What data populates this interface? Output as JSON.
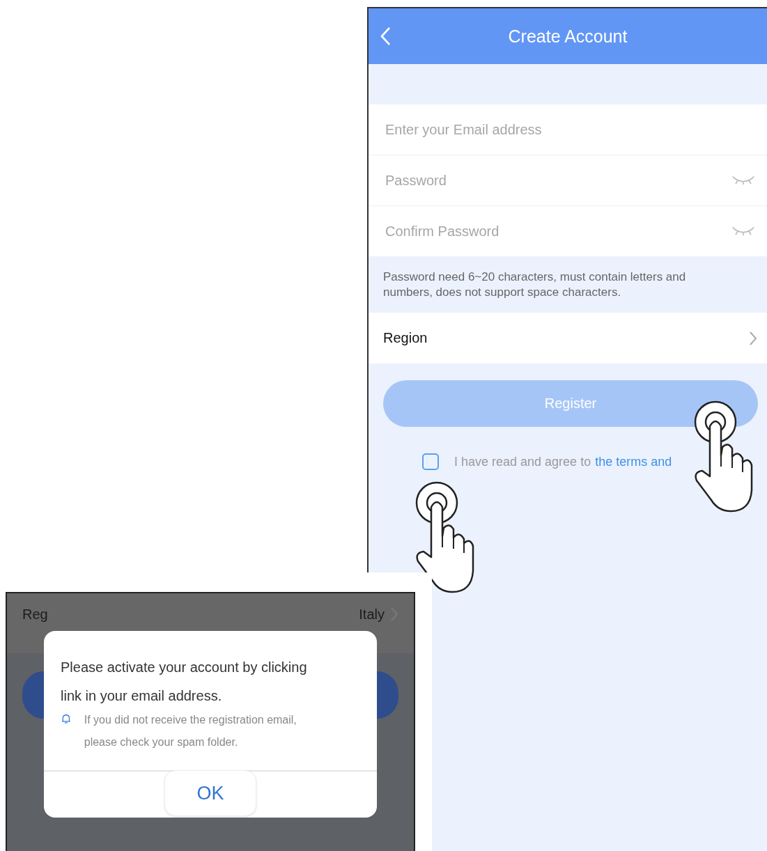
{
  "create_screen": {
    "title": "Create Account",
    "fields": [
      {
        "placeholder": "Enter your Email address",
        "kind": "text"
      },
      {
        "placeholder": "Password",
        "kind": "password"
      },
      {
        "placeholder": "Confirm Password",
        "kind": "password"
      }
    ],
    "hint": "Password need 6~20 characters, must contain letters and numbers, does not support space characters.",
    "region": {
      "label": "Region"
    },
    "register_button": {
      "label": "Register",
      "disabled": true
    },
    "agreement": {
      "checked": false,
      "text": "I have read and agree to",
      "link": "the terms and"
    }
  },
  "dialog_screen": {
    "region_label": "Reg",
    "region_value": "Italy",
    "dialog": {
      "message": "Please activate your account by clicking link in your email address.",
      "note": "If you did not receive the registration email, please check your spam folder.",
      "button": "OK"
    }
  }
}
